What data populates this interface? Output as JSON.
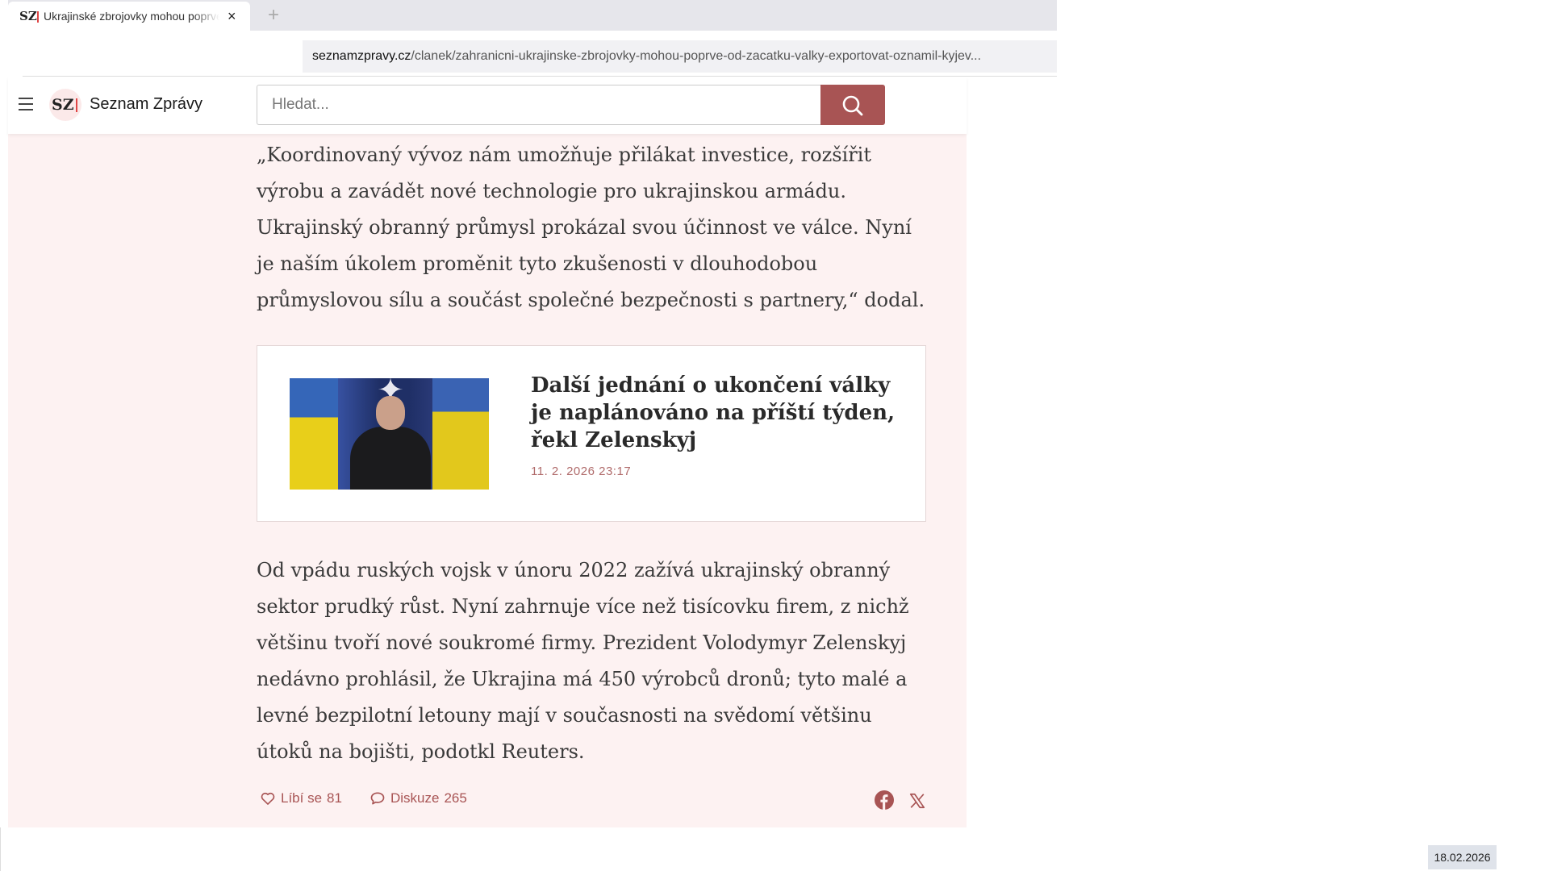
{
  "browser": {
    "tab": {
      "favicon": "SZ",
      "title": "Ukrajinské zbrojovky mohou poprve od začátku války exportovat",
      "close_icon": "×"
    },
    "new_tab_icon": "+",
    "url_domain": "seznamzpravy.cz",
    "url_path": "/clanek/zahranicni-ukrajinske-zbrojovky-mohou-poprve-od-zacatku-valky-exportovat-oznamil-kyjev..."
  },
  "header": {
    "logo_mark": "SZ",
    "logo_text": "Seznam Zprávy",
    "search_placeholder": "Hledat..."
  },
  "article": {
    "paragraph_1": "„Koordinovaný vývoz nám umožňuje přilákat investice, rozšířit výrobu a zavádět nové technologie pro ukrajinskou armádu. Ukrajinský obranný průmysl prokázal svou účinnost ve válce. Nyní je naším úkolem proměnit tyto zkušenosti v dlouhodobou průmyslovou sílu a součást společné bezpečnosti s partnery,“ dodal.",
    "related": {
      "title": "Další jednání o ukončení války je naplánováno na příští týden, řekl Zelenskyj",
      "date": "11. 2. 2026 23:17"
    },
    "paragraph_2": "Od vpádu ruských vojsk v únoru 2022 zažívá ukrajinský obranný sektor prudký růst. Nyní zahrnuje více než tisícovku firem, z nichž většinu tvoří nové soukromé firmy. Prezident Volodymyr Zelenskyj nedávno prohlásil, že Ukrajina má 450 výrobců dronů; tyto malé a levné bezpilotní letouny mají v současnosti na svědomí většinu útoků na bojišti, podotkl Reuters."
  },
  "actions": {
    "like_label": "Líbí se",
    "like_count": "81",
    "discussion_label": "Diskuze",
    "discussion_count": "265"
  },
  "taskbar": {
    "date": "18.02.2026"
  },
  "colors": {
    "accent": "#a85454",
    "article_background": "#fdf2f2",
    "date_text": "#b06b6b"
  },
  "icons": [
    "close-icon",
    "plus-icon",
    "hamburger-icon",
    "search-icon",
    "heart-icon",
    "comment-icon",
    "facebook-icon",
    "x-icon"
  ]
}
